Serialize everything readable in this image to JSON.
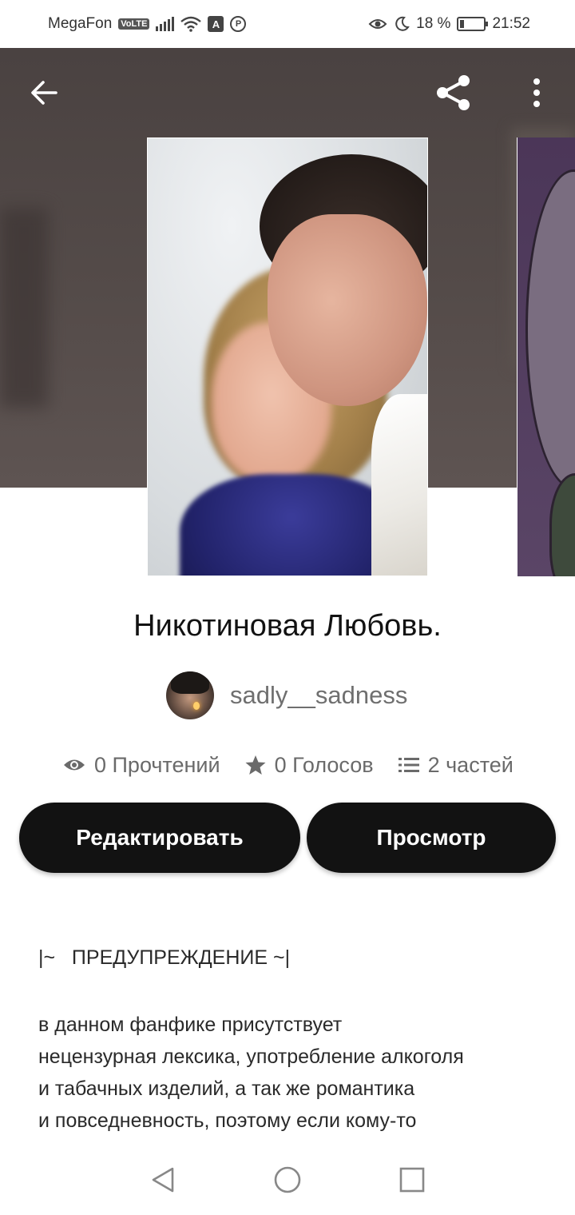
{
  "status_bar": {
    "carrier": "MegaFon",
    "network_badge": "VoLTE",
    "app_badge_a": "A",
    "app_badge_p": "P",
    "battery_percent": "18 %",
    "battery_level": 0.18,
    "time": "21:52",
    "icons": [
      "signal-icon",
      "wifi-icon",
      "eye-comfort-icon",
      "moon-icon",
      "battery-icon"
    ]
  },
  "toolbar": {
    "back_icon": "arrow-left-icon",
    "share_icon": "share-icon",
    "more_icon": "more-vertical-icon"
  },
  "story": {
    "title": "Никотиновая Любовь.",
    "author": "sadly__sadness",
    "stats": {
      "reads": "0 Прочтений",
      "votes": "0 Голосов",
      "parts": "2 частей"
    }
  },
  "actions": {
    "edit_label": "Редактировать",
    "preview_label": "Просмотр"
  },
  "description": {
    "warning": "|~   ПРЕДУПРЕЖДЕНИЕ ~|",
    "lines": [
      "в данном фанфике присутствует",
      "нецензурная лексика, употребление алкоголя",
      "и табачных изделий, а так же романтика",
      "и повседневность, поэтому если кому-то"
    ]
  },
  "nav_bar": {
    "icons": [
      "nav-back-icon",
      "nav-home-icon",
      "nav-recents-icon"
    ]
  },
  "colors": {
    "button_bg": "#121212",
    "header_bg": "#4f4745",
    "muted_text": "#6f6f6f"
  }
}
